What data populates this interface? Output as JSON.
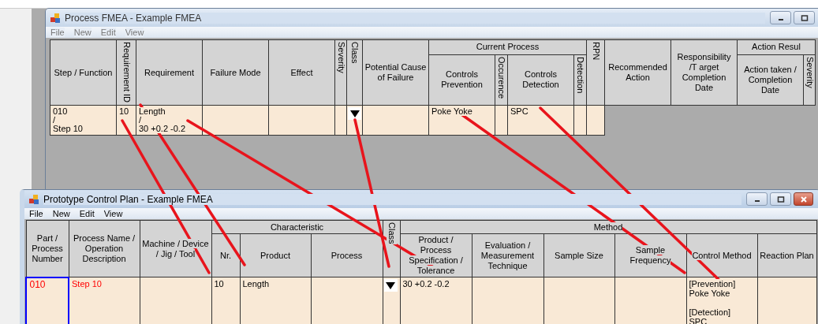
{
  "windows": [
    {
      "title": "Process FMEA - Example FMEA",
      "active": false,
      "buttons": [
        {
          "kind": "minimize"
        },
        {
          "kind": "maximize"
        }
      ],
      "menu": [
        "File",
        "New",
        "Edit",
        "View"
      ],
      "table": {
        "columns": [
          {
            "kind": "column",
            "label": "Step / Function",
            "vertical": false
          },
          {
            "kind": "column",
            "label": "Requirement ID",
            "vertical": true
          },
          {
            "kind": "column",
            "label": "Requirement",
            "vertical": false
          },
          {
            "kind": "column",
            "label": "Failure Mode",
            "vertical": false
          },
          {
            "kind": "column",
            "label": "Effect",
            "vertical": false
          },
          {
            "kind": "column",
            "label": "Severity",
            "vertical": true
          },
          {
            "kind": "column",
            "label": "Class",
            "vertical": true
          },
          {
            "kind": "column",
            "label": "Potential Cause of Failure",
            "vertical": false
          },
          {
            "kind": "group",
            "label": "Current Process",
            "colspan": 4,
            "columns": [
              {
                "label": "Controls Prevention",
                "vertical": false
              },
              {
                "label": "Occurence",
                "vertical": true
              },
              {
                "label": "Controls Detection",
                "vertical": false
              },
              {
                "label": "Detection",
                "vertical": true
              }
            ]
          },
          {
            "kind": "column",
            "label": "RPN",
            "vertical": true
          },
          {
            "kind": "column",
            "label": "Recommended Action",
            "vertical": false
          },
          {
            "kind": "column",
            "label": "Responsibility /T arget Completion Date",
            "vertical": false
          },
          {
            "kind": "group",
            "label": "Action Resul",
            "colspan": 2,
            "columns": [
              {
                "label": "Action taken / Completion Date",
                "vertical": false
              },
              {
                "label": "Severity",
                "vertical": true
              }
            ]
          }
        ],
        "rows": [
          {
            "cells": [
              {
                "kind": "text",
                "text": "010\n/\nStep 10"
              },
              {
                "kind": "text",
                "text": "10"
              },
              {
                "kind": "text",
                "text": "Length\n/\n30 +0.2 -0.2"
              },
              {
                "kind": "empty"
              },
              {
                "kind": "empty"
              },
              {
                "kind": "empty"
              },
              {
                "kind": "dropdown"
              },
              {
                "kind": "empty"
              },
              {
                "kind": "text",
                "text": "Poke Yoke"
              },
              {
                "kind": "empty"
              },
              {
                "kind": "text",
                "text": "SPC"
              },
              {
                "kind": "empty"
              },
              {
                "kind": "empty"
              }
            ]
          }
        ]
      }
    },
    {
      "title": "Prototype Control Plan - Example FMEA",
      "active": true,
      "buttons": [
        {
          "kind": "minimize"
        },
        {
          "kind": "maximize"
        },
        {
          "kind": "close"
        }
      ],
      "menu": [
        "File",
        "New",
        "Edit",
        "View"
      ],
      "table": {
        "columns": [
          {
            "kind": "column",
            "label": "Part / Process Number",
            "vertical": false
          },
          {
            "kind": "column",
            "label": "Process Name / Operation Description",
            "vertical": false
          },
          {
            "kind": "column",
            "label": "Machine / Device / Jig / Tool",
            "vertical": false
          },
          {
            "kind": "group",
            "label": "Characteristic",
            "colspan": 3,
            "columns": [
              {
                "label": "Nr.",
                "vertical": false
              },
              {
                "label": "Product",
                "vertical": false
              },
              {
                "label": "Process",
                "vertical": false
              }
            ]
          },
          {
            "kind": "column",
            "label": "Class",
            "vertical": true
          },
          {
            "kind": "group",
            "label": "Method",
            "colspan": 6,
            "columns": [
              {
                "label": "Product / Process Specification / Tolerance",
                "vertical": false
              },
              {
                "label": "Evaluation / Measurement Technique",
                "vertical": false
              },
              {
                "label": "Sample Size",
                "vertical": false
              },
              {
                "label": "Sample Frequency",
                "vertical": false
              },
              {
                "label": "Control Method",
                "vertical": false
              },
              {
                "label": "Reaction Plan",
                "vertical": false
              }
            ]
          }
        ],
        "rows": [
          {
            "cells": [
              {
                "kind": "text",
                "text": "010",
                "color": "#ff0000",
                "selected": true
              },
              {
                "kind": "text",
                "text": "Step 10",
                "color": "#ff0000",
                "selected": false
              },
              {
                "kind": "empty",
                "selected": false
              },
              {
                "kind": "text",
                "text": "10",
                "selected": false
              },
              {
                "kind": "text",
                "text": "Length",
                "selected": false
              },
              {
                "kind": "empty",
                "selected": false
              },
              {
                "kind": "dropdown",
                "selected": false
              },
              {
                "kind": "text",
                "text": "30 +0.2 -0.2",
                "selected": false
              },
              {
                "kind": "empty",
                "selected": false
              },
              {
                "kind": "empty",
                "selected": false
              },
              {
                "kind": "empty",
                "selected": false
              },
              {
                "kind": "text",
                "text": "[Prevention]\nPoke Yoke\n\n[Detection]\nSPC",
                "selected": false
              },
              {
                "kind": "empty",
                "selected": false
              }
            ]
          }
        ]
      }
    }
  ]
}
